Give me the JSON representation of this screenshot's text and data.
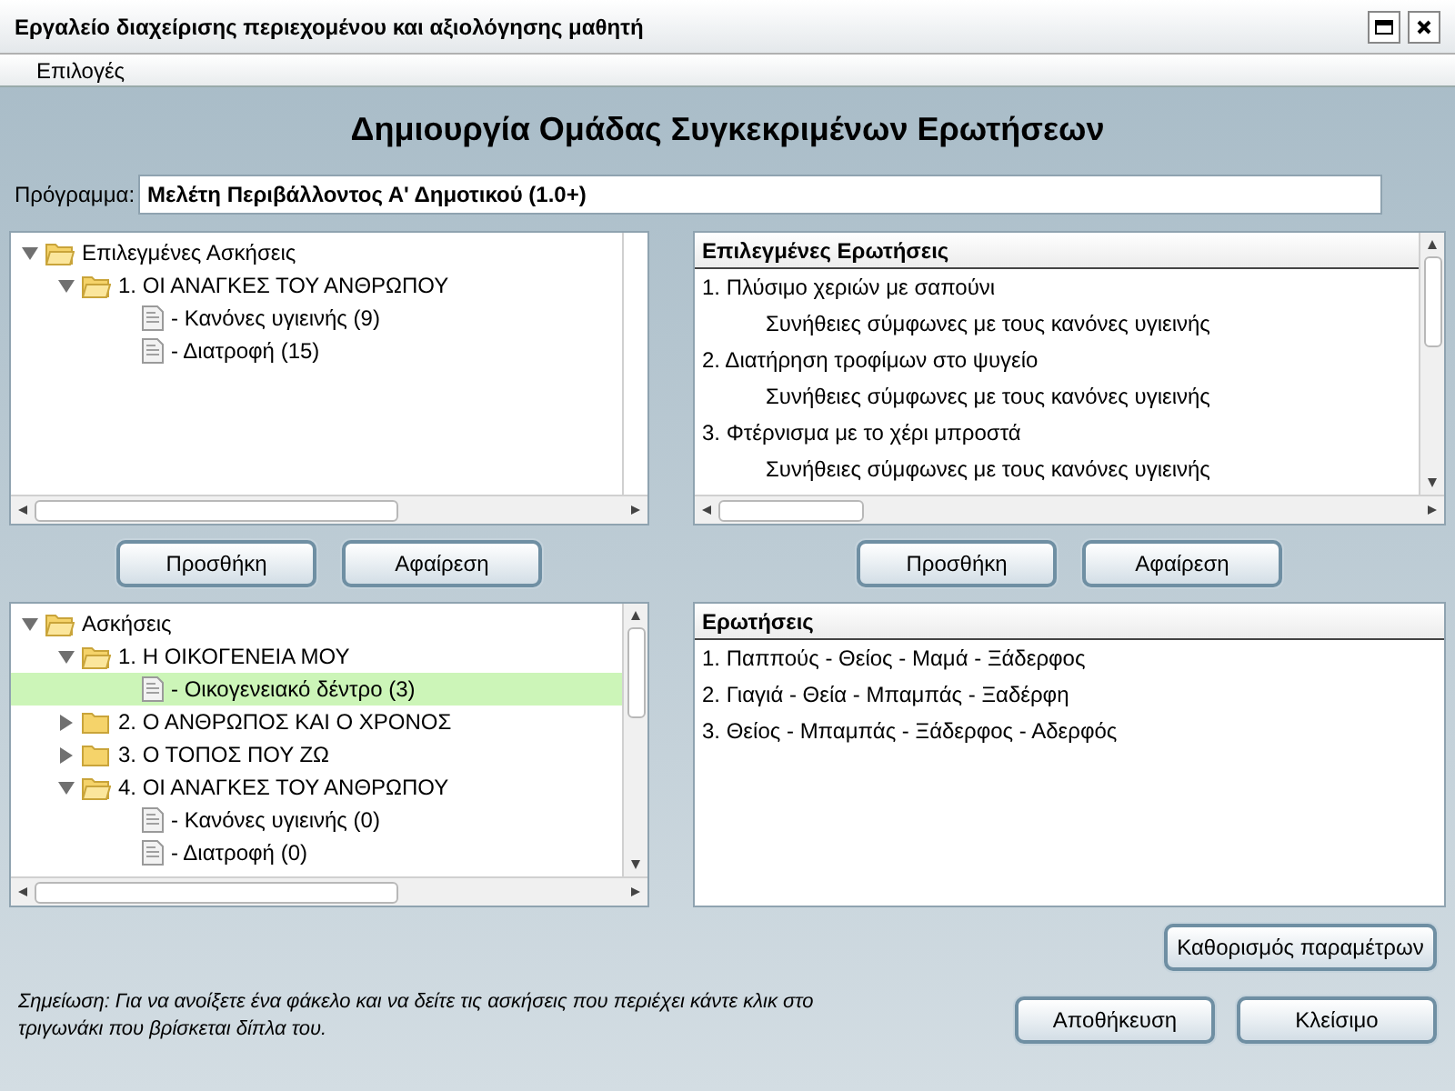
{
  "window": {
    "title": "Εργαλείο διαχείρισης περιεχομένου και αξιολόγησης μαθητή"
  },
  "menu": [
    "Επιλογές"
  ],
  "heading": "Δημιουργία Ομάδας Συγκεκριμένων Ερωτήσεων",
  "program": {
    "label": "Πρόγραμμα:",
    "value": "Μελέτη Περιβάλλοντος Α' Δημοτικού (1.0+)"
  },
  "selected_tree": [
    {
      "kind": "folder",
      "label": "Επιλεγμένες Ασκήσεις",
      "expanded": true,
      "selected": false,
      "children": [
        {
          "kind": "folder",
          "label": "1.  ΟΙ ΑΝΑΓΚΕΣ ΤΟΥ ΑΝΘΡΩΠΟΥ",
          "expanded": true,
          "selected": false,
          "children": [
            {
              "kind": "document",
              "label": "- Κανόνες υγιεινής  (9)",
              "selected": false
            },
            {
              "kind": "document",
              "label": "- Διατροφή  (15)",
              "selected": false
            }
          ]
        }
      ]
    }
  ],
  "selected_questions": {
    "header": "Επιλεγμένες Ερωτήσεις",
    "items": [
      {
        "title": "1. Πλύσιμο χεριών με σαπούνι",
        "subtitle": "Συνήθειες σύμφωνες με τους κανόνες υγιεινής"
      },
      {
        "title": "2. Διατήρηση τροφίμων στο ψυγείο",
        "subtitle": "Συνήθειες σύμφωνες με τους κανόνες υγιεινής"
      },
      {
        "title": "3. Φτέρνισμα με το χέρι μπροστά",
        "subtitle": "Συνήθειες σύμφωνες με τους κανόνες υγιεινής"
      }
    ]
  },
  "left_buttons": [
    "Προσθήκη",
    "Αφαίρεση"
  ],
  "right_buttons": [
    "Προσθήκη",
    "Αφαίρεση"
  ],
  "exercise_tree": [
    {
      "kind": "folder",
      "label": "Ασκήσεις",
      "expanded": true,
      "selected": false,
      "children": [
        {
          "kind": "folder",
          "label": "1.  Η ΟΙΚΟΓΕΝΕΙΑ ΜΟΥ",
          "expanded": true,
          "selected": false,
          "children": [
            {
              "kind": "document",
              "label": "- Οικογενειακό δέντρο  (3)",
              "selected": true
            }
          ]
        },
        {
          "kind": "folder",
          "label": "2.  Ο ΑΝΘΡΩΠΟΣ ΚΑΙ Ο ΧΡΟΝΟΣ",
          "expanded": false,
          "selected": false
        },
        {
          "kind": "folder",
          "label": "3.  Ο ΤΟΠΟΣ ΠΟΥ ΖΩ",
          "expanded": false,
          "selected": false
        },
        {
          "kind": "folder",
          "label": "4.  ΟΙ ΑΝΑΓΚΕΣ ΤΟΥ ΑΝΘΡΩΠΟΥ",
          "expanded": true,
          "selected": false,
          "children": [
            {
              "kind": "document",
              "label": "- Κανόνες υγιεινής  (0)",
              "selected": false
            },
            {
              "kind": "document",
              "label": "- Διατροφή  (0)",
              "selected": false
            }
          ]
        }
      ]
    }
  ],
  "questions": {
    "header": "Ερωτήσεις",
    "items": [
      {
        "title": "1. Παππούς - Θείος - Μαμά - Ξάδερφος"
      },
      {
        "title": "2. Γιαγιά - Θεία - Μπαμπάς - Ξαδέρφη"
      },
      {
        "title": "3. Θείος - Μπαμπάς - Ξάδερφος - Αδερφός"
      }
    ]
  },
  "parameters_button": "Καθορισμός παραμέτρων",
  "note": "Σημείωση: Για να ανοίξετε ένα φάκελο και να δείτε τις ασκήσεις που περιέχει κάντε κλικ στο τριγωνάκι που βρίσκεται δίπλα του.",
  "buttons": [
    "Αποθήκευση",
    "Κλείσιμο"
  ]
}
